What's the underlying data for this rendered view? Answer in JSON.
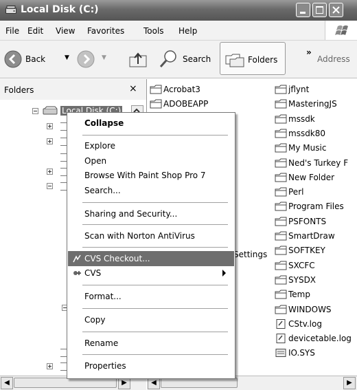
{
  "window": {
    "title": "Local Disk (C:)"
  },
  "menubar": {
    "items": [
      "File",
      "Edit",
      "View",
      "Favorites",
      "Tools",
      "Help"
    ]
  },
  "toolbar": {
    "back_label": "Back",
    "search_label": "Search",
    "folders_label": "Folders",
    "overflow_label": "»",
    "address_label": "Address"
  },
  "folders_pane": {
    "title": "Folders",
    "close_symbol": "×",
    "root_label": "Local Disk (C:)"
  },
  "files": {
    "col1": [
      "Acrobat3",
      "ADOBEAPP"
    ],
    "col1_partial": "Settings",
    "col2": [
      "jflynt",
      "MasteringJS",
      "mssdk",
      "mssdk80",
      "My Music",
      "Ned's Turkey F",
      "New Folder",
      "Perl",
      "Program Files",
      "PSFONTS",
      "SmartDraw",
      "SOFTKEY",
      "SXCFC",
      "SYSDX",
      "Temp",
      "WINDOWS"
    ],
    "col2_files": [
      "CStv.log",
      "devicetable.log",
      "IO.SYS"
    ]
  },
  "context_menu": {
    "collapse": "Collapse",
    "explore": "Explore",
    "open": "Open",
    "browse_psp": "Browse With Paint Shop Pro 7",
    "search": "Search...",
    "sharing": "Sharing and Security...",
    "scan": "Scan with Norton AntiVirus",
    "cvs_checkout": "CVS Checkout...",
    "cvs": "CVS",
    "format": "Format...",
    "copy": "Copy",
    "rename": "Rename",
    "properties": "Properties"
  },
  "colors": {
    "title_bar": "#6a6a6a",
    "highlight": "#6e6e6e",
    "folder_outline": "#555555"
  },
  "icons": [
    "folder-icon",
    "back-arrow-icon",
    "forward-arrow-icon",
    "up-folder-icon",
    "search-icon",
    "folders-icon",
    "windows-logo-icon",
    "drive-icon",
    "log-file-icon",
    "sys-file-icon",
    "cvs-icon"
  ]
}
